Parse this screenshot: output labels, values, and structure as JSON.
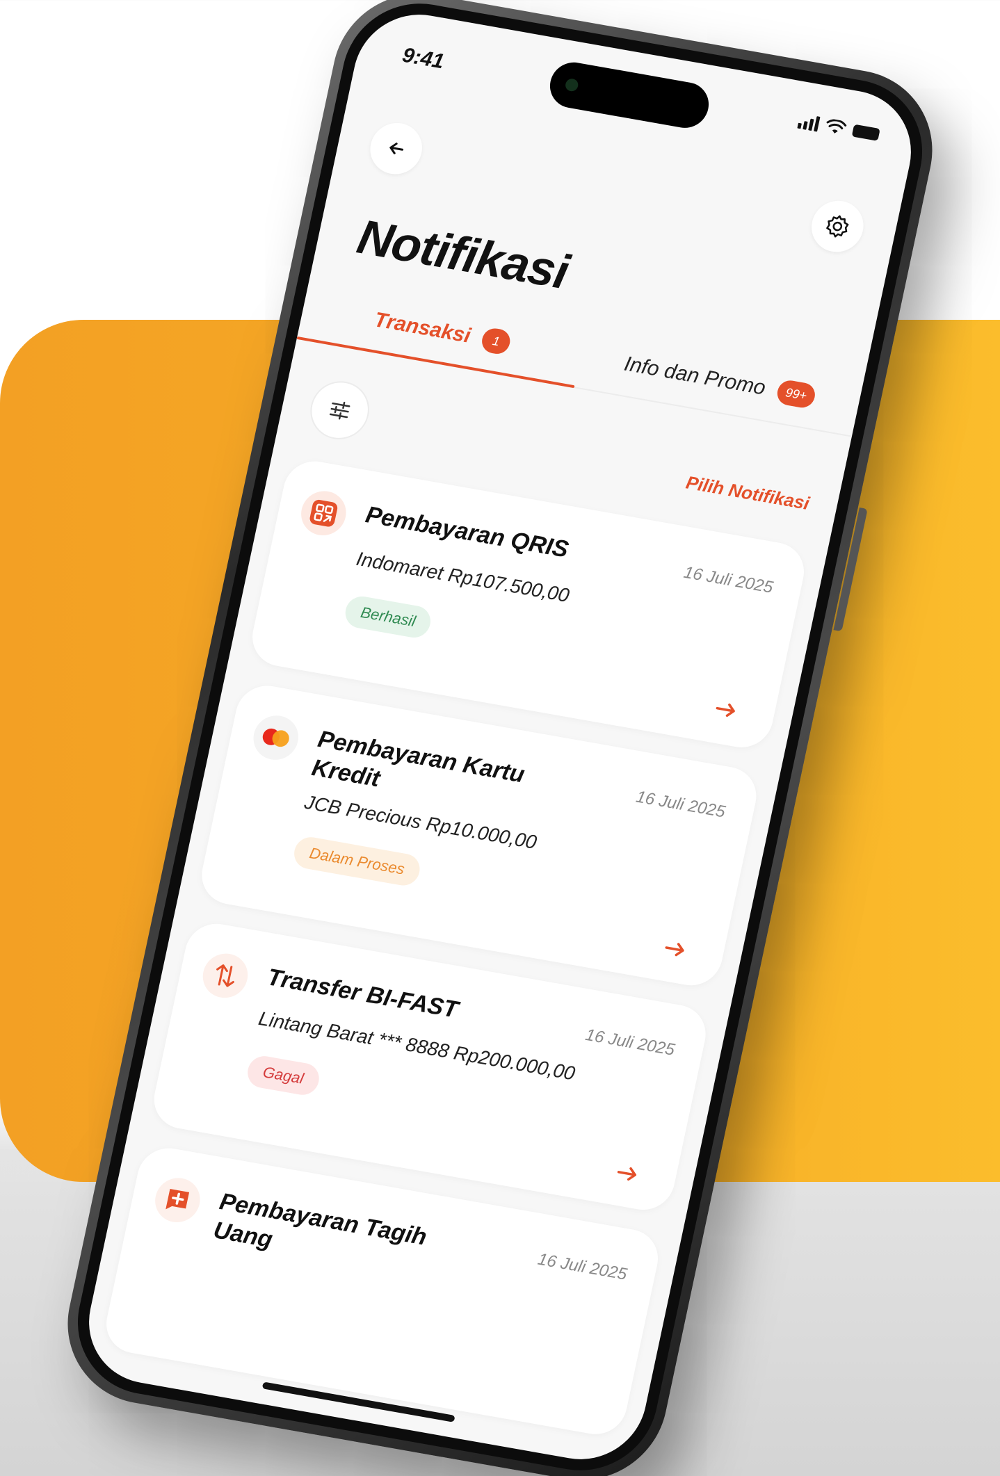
{
  "status_bar": {
    "time": "9:41"
  },
  "header": {
    "title": "Notifikasi"
  },
  "tabs": [
    {
      "label": "Transaksi",
      "badge": "1",
      "active": true
    },
    {
      "label": "Info dan Promo",
      "badge": "99+",
      "active": false
    }
  ],
  "toolbar": {
    "select_label": "Pilih Notifikasi"
  },
  "notifications": [
    {
      "icon": "qris-icon",
      "title": "Pembayaran QRIS",
      "date": "16 Juli 2025",
      "description": "Indomaret Rp107.500,00",
      "status": "Berhasil"
    },
    {
      "icon": "mastercard-icon",
      "title": "Pembayaran Kartu Kredit",
      "date": "16 Juli 2025",
      "description": "JCB Precious Rp10.000,00",
      "status": "Dalam Proses"
    },
    {
      "icon": "transfer-icon",
      "title": "Transfer BI-FAST",
      "date": "16 Juli 2025",
      "description": "Lintang Barat *** 8888 Rp200.000,00",
      "status": "Gagal"
    },
    {
      "icon": "bill-icon",
      "title": "Pembayaran Tagih Uang",
      "date": "16 Juli 2025"
    }
  ],
  "colors": {
    "accent": "#e4502a",
    "background_orange": "#f6ab26",
    "success": "#2f8a51",
    "process": "#ea8a2e",
    "failed": "#d43c3c"
  }
}
